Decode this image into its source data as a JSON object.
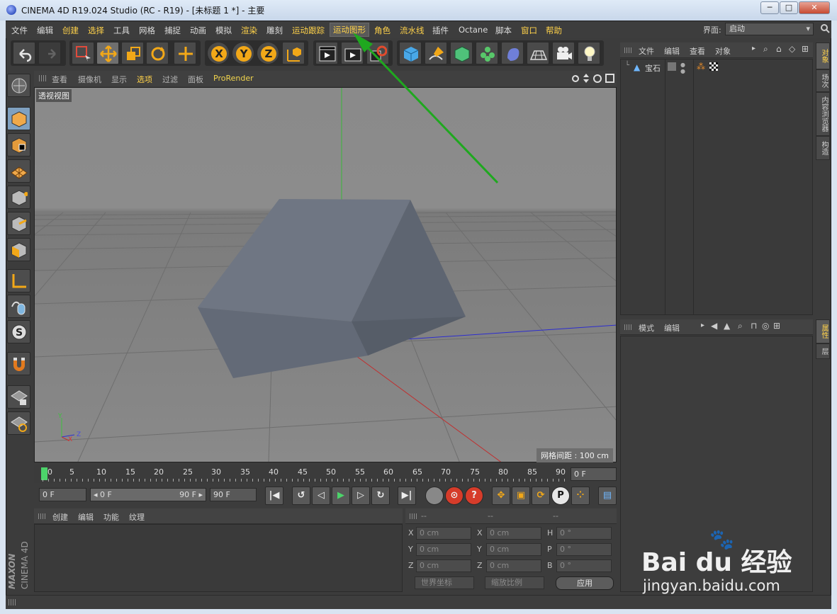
{
  "window": {
    "title": "CINEMA 4D R19.024 Studio (RC - R19) - [未标题 1 *] - 主要",
    "min_label": "─",
    "max_label": "□",
    "close_label": "✕"
  },
  "menubar": {
    "items": [
      "文件",
      "编辑",
      "创建",
      "选择",
      "工具",
      "网格",
      "捕捉",
      "动画",
      "模拟",
      "渲染",
      "雕刻",
      "运动跟踪",
      "运动图形",
      "角色",
      "流水线",
      "插件",
      "Octane",
      "脚本",
      "窗口",
      "帮助"
    ],
    "interface_label": "界面:",
    "interface_value": "启动"
  },
  "viewport": {
    "menu": [
      "查看",
      "摄像机",
      "显示",
      "选项",
      "过滤",
      "面板",
      "ProRender"
    ],
    "label": "透视视图",
    "grid_info": "网格间距 : 100 cm",
    "axis_y": "Y",
    "axis_x": "X",
    "axis_z": "Z"
  },
  "timeline": {
    "ticks": [
      "0",
      "5",
      "10",
      "15",
      "20",
      "25",
      "30",
      "35",
      "40",
      "45",
      "50",
      "55",
      "60",
      "65",
      "70",
      "75",
      "80",
      "85",
      "90"
    ],
    "current_frame": "0 F",
    "start_field": "0 F",
    "range_start": "◂ 0 F",
    "range_end": "90 F ▸",
    "end_field": "90 F"
  },
  "objects_panel": {
    "menu": [
      "文件",
      "编辑",
      "查看",
      "对象"
    ],
    "object_name": "宝石"
  },
  "attributes_panel": {
    "menu": [
      "模式",
      "编辑"
    ]
  },
  "side_tabs": {
    "top": [
      "对象",
      "场次",
      "内容浏览器",
      "构造"
    ],
    "bottom": [
      "属性",
      "层"
    ]
  },
  "material_panel": {
    "menu": [
      "创建",
      "编辑",
      "功能",
      "纹理"
    ]
  },
  "coords": {
    "header": [
      "--",
      "--",
      "--"
    ],
    "rows": [
      {
        "a": "X",
        "av": "0 cm",
        "b": "X",
        "bv": "0 cm",
        "c": "H",
        "cv": "0 °"
      },
      {
        "a": "Y",
        "av": "0 cm",
        "b": "Y",
        "bv": "0 cm",
        "c": "P",
        "cv": "0 °"
      },
      {
        "a": "Z",
        "av": "0 cm",
        "b": "Z",
        "bv": "0 cm",
        "c": "B",
        "cv": "0 °"
      }
    ],
    "world_dropdown": "世界坐标",
    "scale_dropdown": "缩放比例",
    "apply_button": "应用"
  },
  "branding": {
    "maxon": "MAXON",
    "c4d": "CINEMA 4D"
  },
  "watermark": {
    "baidu": "Bai du 经验",
    "url": "jingyan.baidu.com"
  },
  "colors": {
    "accent": "#ffd24a",
    "annotation_arrow": "#1fa81f"
  }
}
